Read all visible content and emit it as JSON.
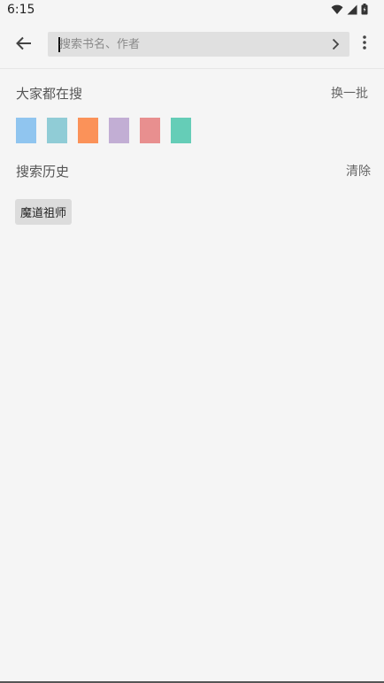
{
  "status_bar": {
    "time": "6:15"
  },
  "toolbar": {
    "search_placeholder": "搜索书名、作者",
    "search_value": ""
  },
  "hot_search": {
    "title": "大家都在搜",
    "action": "换一批",
    "items": [
      {
        "color": "#90c5ef"
      },
      {
        "color": "#90ccd6"
      },
      {
        "color": "#fb9259"
      },
      {
        "color": "#c2aed4"
      },
      {
        "color": "#e88f8f"
      },
      {
        "color": "#65cdb7"
      }
    ]
  },
  "history": {
    "title": "搜索历史",
    "action": "清除",
    "items": [
      "魔道祖师"
    ]
  },
  "colors": {
    "background": "#f5f5f5",
    "search_box": "#e0e0e0",
    "chip": "#dcdcdc"
  }
}
